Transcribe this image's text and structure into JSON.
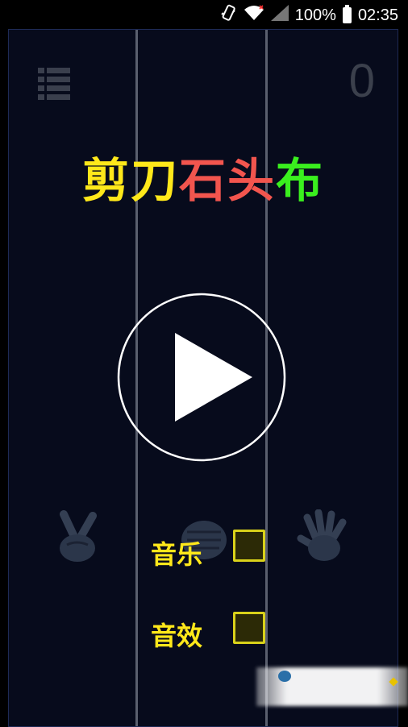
{
  "status_bar": {
    "battery_text": "100%",
    "time": "02:35",
    "icons": [
      "phone-vibrate-icon",
      "wifi-icon",
      "signal-icon",
      "battery-icon"
    ]
  },
  "game": {
    "score": "0",
    "title_chars": [
      "剪",
      "刀",
      "石",
      "头",
      "布"
    ],
    "title_colors": [
      "#ffe81a",
      "#ffe81a",
      "#f2554e",
      "#f2554e",
      "#3aef1e"
    ],
    "hands": [
      "scissors-hand-icon",
      "rock-hand-icon",
      "paper-hand-icon"
    ],
    "options": [
      {
        "label": "音乐",
        "checked": false
      },
      {
        "label": "音效",
        "checked": false
      }
    ],
    "colors": {
      "background": "#070b1c",
      "label": "#ffe81a",
      "checkbox_border": "#d9d21a"
    }
  }
}
